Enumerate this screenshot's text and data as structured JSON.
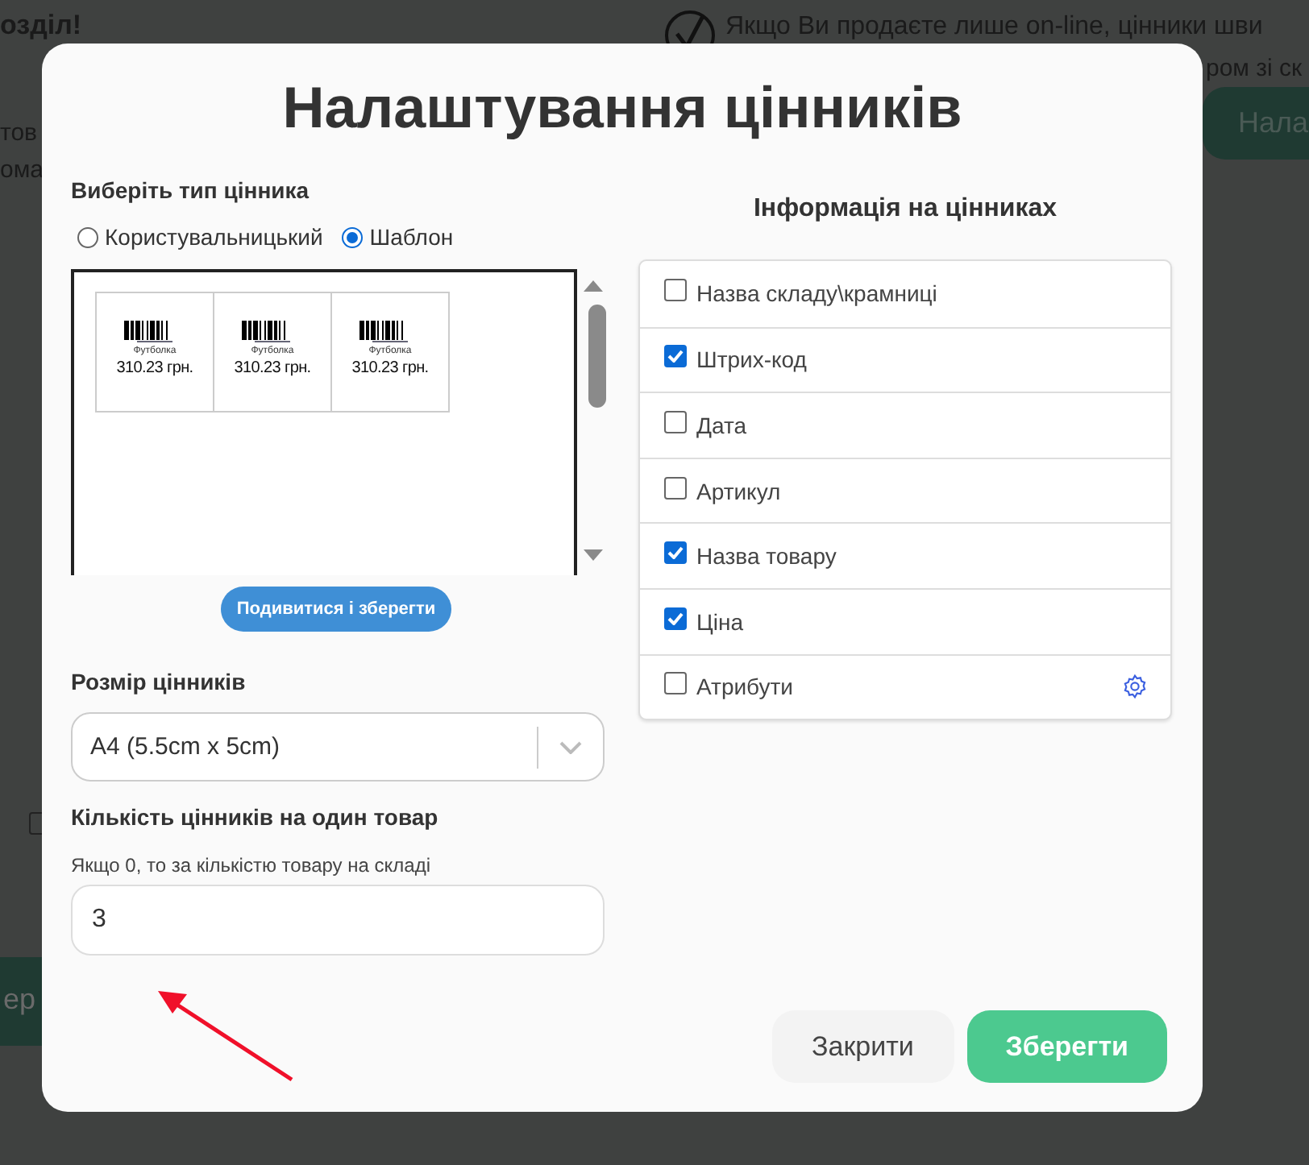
{
  "background": {
    "heading": "озділ!",
    "left_texts": [
      "тов",
      "ома"
    ],
    "notice": "Якщо Ви продаєте лише on-line, цінники шви",
    "notice_continued": "ром зі ск",
    "button": "Нала",
    "bottom_button": "ер"
  },
  "dialog": {
    "title": "Налаштування цінників",
    "type_label": "Виберіть тип цінника",
    "types": [
      {
        "label": "Користувальницький",
        "selected": false
      },
      {
        "label": "Шаблон",
        "selected": true
      }
    ],
    "tags": [
      {
        "product": "Футболка",
        "price": "310.23 грн."
      },
      {
        "product": "Футболка",
        "price": "310.23 грн."
      },
      {
        "product": "Футболка",
        "price": "310.23 грн."
      }
    ],
    "preview_button": "Подивитися і зберегти",
    "size_label": "Розмір цінників",
    "size_value": "A4 (5.5cm x 5cm)",
    "count_label": "Кількість цінників на один товар",
    "count_hint": "Якщо 0, то за кількістю товару на складі",
    "count_value": "3",
    "info_title": "Інформація на цінниках",
    "info_items": [
      {
        "label": "Назва складу\\крамниці",
        "checked": false,
        "kind": "plain"
      },
      {
        "label": "Штрих-код",
        "checked": true,
        "kind": "plain"
      },
      {
        "label": "Дата",
        "checked": false,
        "kind": "plain"
      },
      {
        "label": "Артикул",
        "checked": false,
        "kind": "plain"
      },
      {
        "label": "Назва товару",
        "checked": true,
        "kind": "plain"
      },
      {
        "label": "Ціна",
        "checked": true,
        "kind": "plain"
      },
      {
        "label": "Атрибути",
        "checked": false,
        "kind": "settings"
      }
    ],
    "buttons": [
      {
        "label": "Закрити",
        "kind": "secondary"
      },
      {
        "label": "Зберегти",
        "kind": "primary"
      }
    ]
  }
}
